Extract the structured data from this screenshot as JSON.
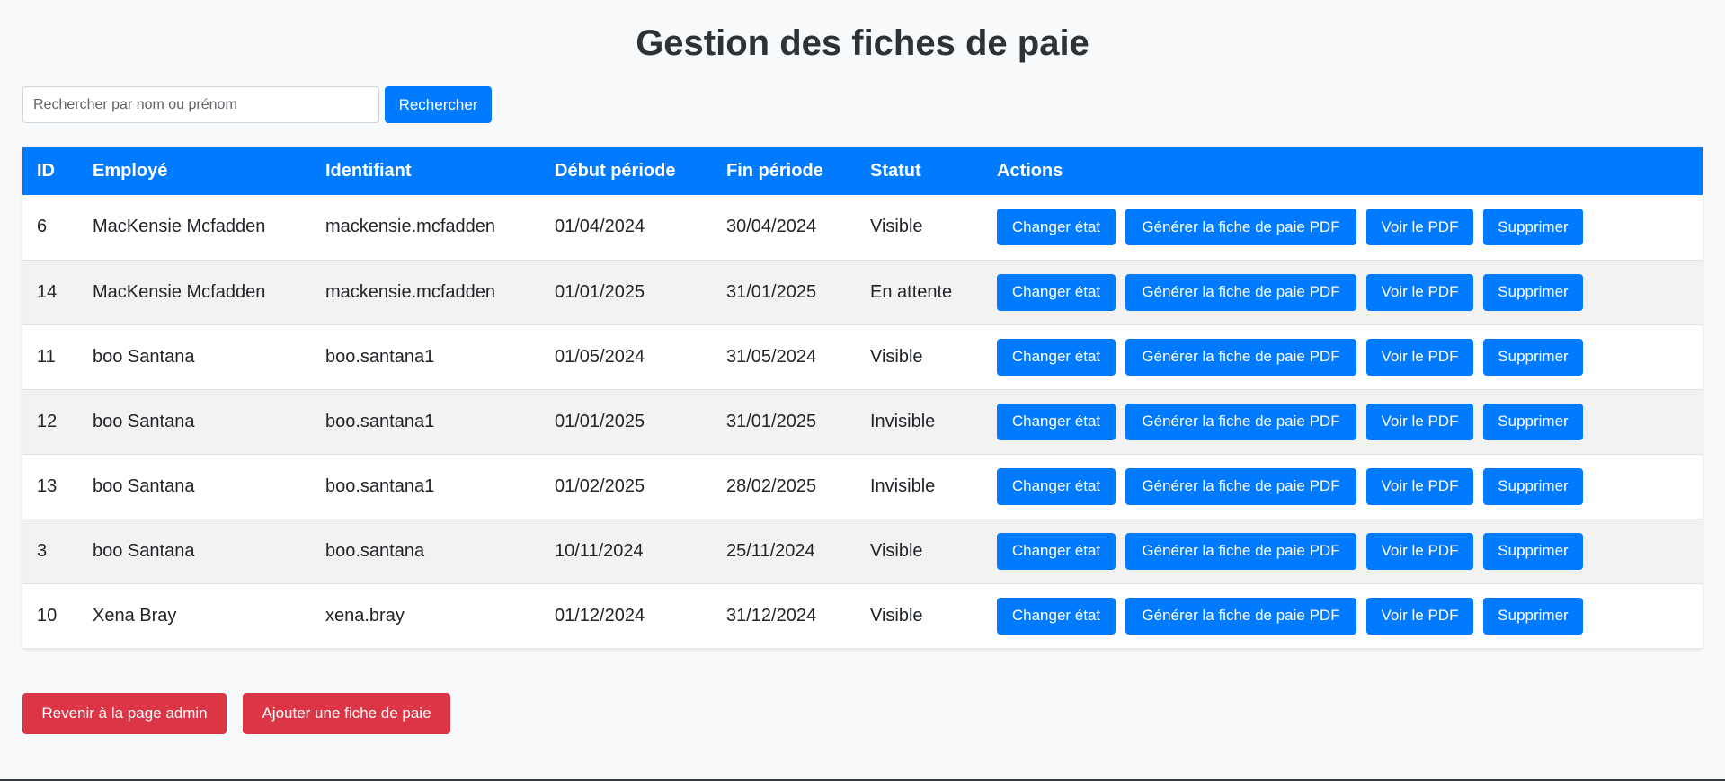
{
  "page_title": "Gestion des fiches de paie",
  "search": {
    "placeholder": "Rechercher par nom ou prénom",
    "value": "",
    "button_label": "Rechercher"
  },
  "table": {
    "headers": [
      "ID",
      "Employé",
      "Identifiant",
      "Début période",
      "Fin période",
      "Statut",
      "Actions"
    ],
    "rows": [
      {
        "id": "6",
        "employee": "MacKensie Mcfadden",
        "login": "mackensie.mcfadden",
        "start": "01/04/2024",
        "end": "30/04/2024",
        "status": "Visible"
      },
      {
        "id": "14",
        "employee": "MacKensie Mcfadden",
        "login": "mackensie.mcfadden",
        "start": "01/01/2025",
        "end": "31/01/2025",
        "status": "En attente"
      },
      {
        "id": "11",
        "employee": "boo Santana",
        "login": "boo.santana1",
        "start": "01/05/2024",
        "end": "31/05/2024",
        "status": "Visible"
      },
      {
        "id": "12",
        "employee": "boo Santana",
        "login": "boo.santana1",
        "start": "01/01/2025",
        "end": "31/01/2025",
        "status": "Invisible"
      },
      {
        "id": "13",
        "employee": "boo Santana",
        "login": "boo.santana1",
        "start": "01/02/2025",
        "end": "28/02/2025",
        "status": "Invisible"
      },
      {
        "id": "3",
        "employee": "boo Santana",
        "login": "boo.santana",
        "start": "10/11/2024",
        "end": "25/11/2024",
        "status": "Visible"
      },
      {
        "id": "10",
        "employee": "Xena Bray",
        "login": "xena.bray",
        "start": "01/12/2024",
        "end": "31/12/2024",
        "status": "Visible"
      }
    ],
    "actions": {
      "change_state": "Changer état",
      "generate_pdf": "Générer la fiche de paie PDF",
      "view_pdf": "Voir le PDF",
      "delete": "Supprimer"
    }
  },
  "footer": {
    "back_label": "Revenir à la page admin",
    "add_label": "Ajouter une fiche de paie"
  },
  "colors": {
    "primary": "#007bff",
    "danger": "#dc3545",
    "background": "#f8f9fa",
    "title": "#2c3338"
  }
}
